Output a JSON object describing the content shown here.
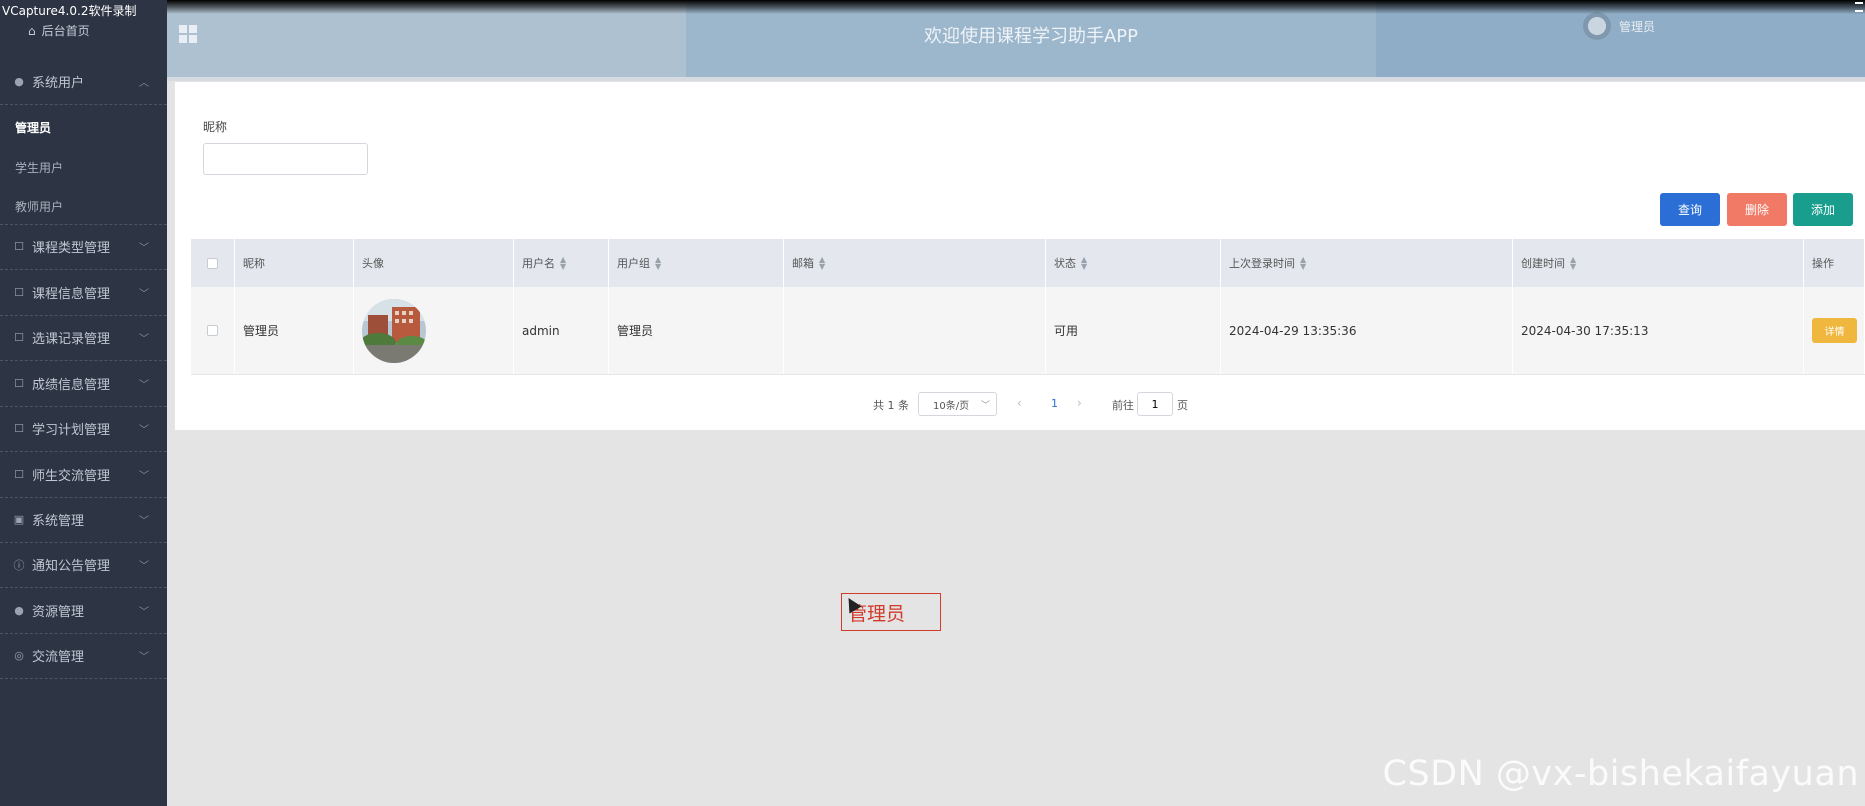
{
  "recorder": {
    "label": "VCapture4.0.2软件录制"
  },
  "header": {
    "title": "欢迎使用课程学习助手APP",
    "user": "管理员"
  },
  "sidebar": {
    "home": "后台首页",
    "system_users": "系统用户",
    "sub_items": [
      "管理员",
      "学生用户",
      "教师用户"
    ],
    "groups": [
      "课程类型管理",
      "课程信息管理",
      "选课记录管理",
      "成绩信息管理",
      "学习计划管理",
      "师生交流管理",
      "系统管理",
      "通知公告管理",
      "资源管理",
      "交流管理"
    ]
  },
  "search": {
    "label": "昵称",
    "value": ""
  },
  "buttons": {
    "query": "查询",
    "delete": "删除",
    "add": "添加",
    "detail": "详情"
  },
  "table": {
    "columns": [
      "昵称",
      "头像",
      "用户名",
      "用户组",
      "邮箱",
      "状态",
      "上次登录时间",
      "创建时间",
      "操作"
    ],
    "rows": [
      {
        "nickname": "管理员",
        "username": "admin",
        "group": "管理员",
        "email": "",
        "status": "可用",
        "last_login": "2024-04-29 13:35:36",
        "created": "2024-04-30 17:35:13"
      }
    ]
  },
  "pagination": {
    "total": "共 1 条",
    "page_size": "10条/页",
    "current": "1",
    "goto_label": "前往",
    "goto_value": "1",
    "unit": "页"
  },
  "floating_label": "管理员",
  "watermark": "CSDN @vx-bishekaifayuan"
}
